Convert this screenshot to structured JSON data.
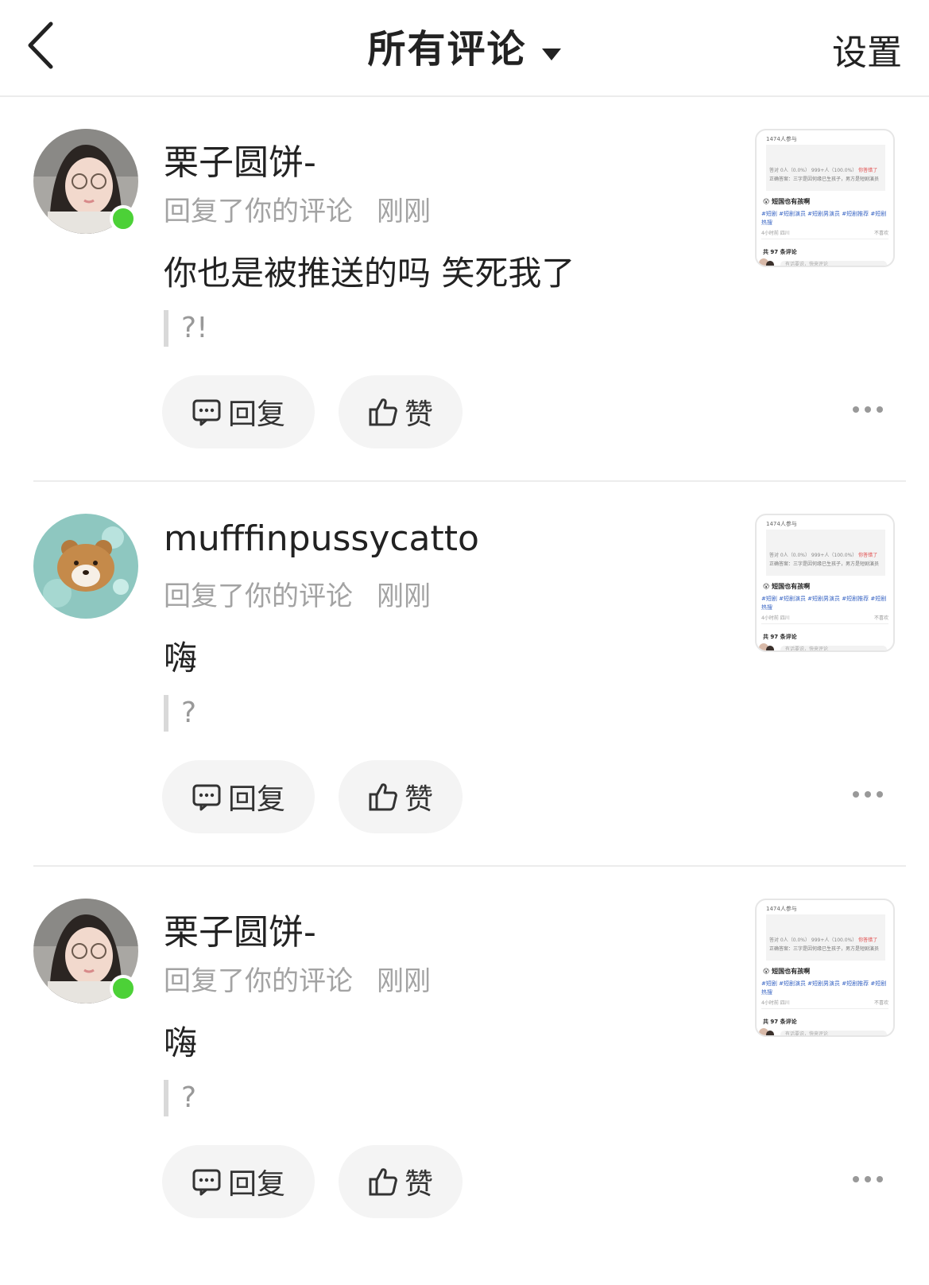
{
  "header": {
    "title": "所有评论",
    "settings_label": "设置"
  },
  "comments": [
    {
      "username": "栗子圆饼-",
      "action": "回复了你的评论",
      "time": "刚刚",
      "text": "你也是被推送的吗 笑死我了",
      "quote": "?!",
      "online": true,
      "avatar": "girl-avatar"
    },
    {
      "username": "mufffinpussycatto",
      "action": "回复了你的评论",
      "time": "刚刚",
      "text": "嗨",
      "quote": "?",
      "online": false,
      "avatar": "bear-avatar"
    },
    {
      "username": "栗子圆饼-",
      "action": "回复了你的评论",
      "time": "刚刚",
      "text": "嗨",
      "quote": "?",
      "online": true,
      "avatar": "girl-avatar"
    }
  ],
  "actions": {
    "reply_label": "回复",
    "like_label": "赞"
  },
  "thumbnail": {
    "participants": "1474人参与",
    "vote_left": "答对 0人（0.0%）",
    "vote_right": "999+人（100.0%）",
    "vote_badge": "你答错了",
    "answer": "正确答案：三字是因何缘已生孩子，男方是短剧演员",
    "title": "短国也有孩啊",
    "tags": "#短剧 #短剧演员 #短剧男演员 #短剧推荐 #短剧热搜",
    "time": "4小时前 四川",
    "fav": "不喜欢",
    "comment_count": "共 97 条评论",
    "input_placeholder": "有话要说，快来评论"
  },
  "colors": {
    "online": "#4cd137",
    "muted": "#a3a3a3",
    "pill_bg": "#f4f4f4"
  }
}
